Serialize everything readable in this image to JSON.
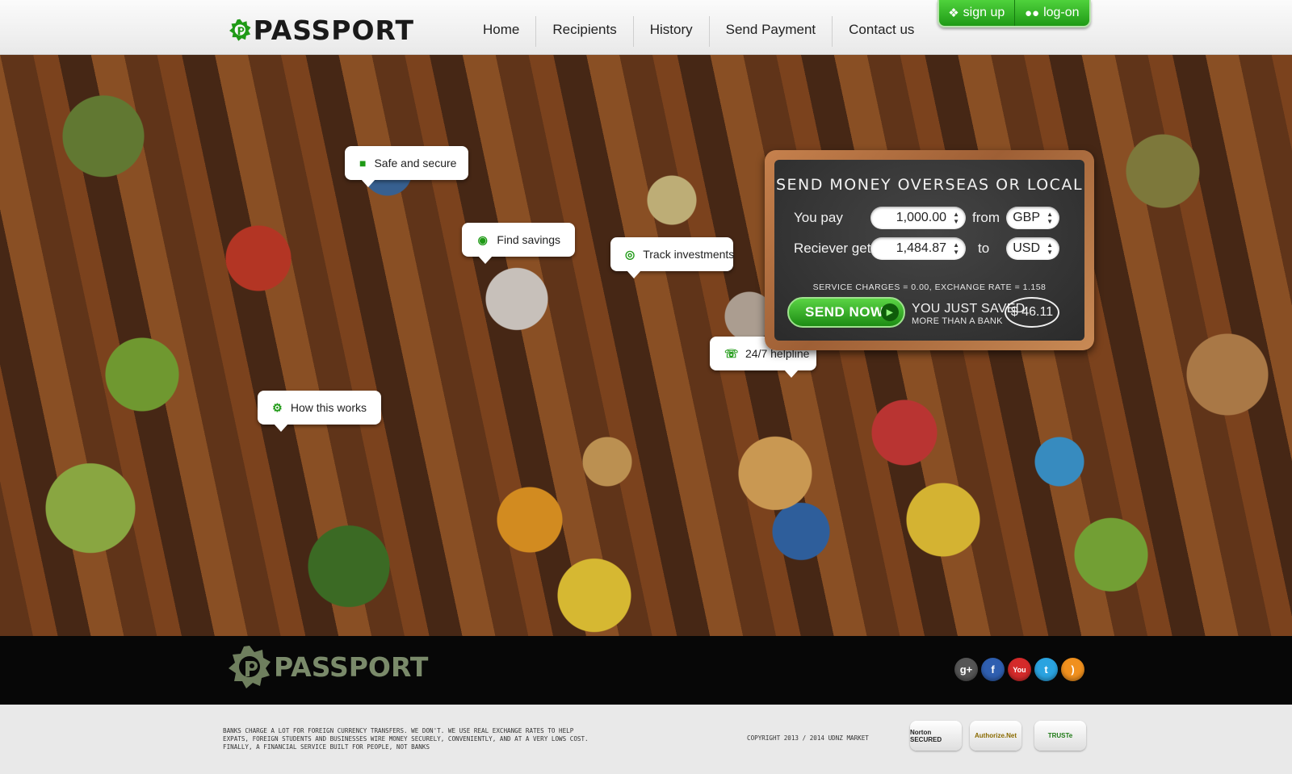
{
  "brand": {
    "name": "PASSPORT",
    "accent": "#1f9a16"
  },
  "nav": {
    "items": [
      {
        "label": "Home"
      },
      {
        "label": "Recipients"
      },
      {
        "label": "History"
      },
      {
        "label": "Send Payment"
      },
      {
        "label": "Contact us"
      }
    ]
  },
  "auth": {
    "signup": {
      "label": "sign up",
      "icon": "signup-person-icon"
    },
    "login": {
      "label": "log-on",
      "icon": "users-icon"
    }
  },
  "features": [
    {
      "label": "Safe and secure",
      "icon": "lock-icon"
    },
    {
      "label": "Find savings",
      "icon": "piggy-bank-icon"
    },
    {
      "label": "Track investments",
      "icon": "target-icon"
    },
    {
      "label": "24/7 helpline",
      "icon": "phone-icon"
    },
    {
      "label": "How this works",
      "icon": "gear-icon"
    }
  ],
  "converter": {
    "title": "SEND MONEY OVERSEAS OR LOCAL",
    "you_pay_label": "You pay",
    "you_pay_value": "1,000.00",
    "from_label": "from",
    "from_currency": "GBP",
    "receiver_label": "Reciever gets",
    "receiver_value": "1,484.87",
    "to_label": "to",
    "to_currency": "USD",
    "charges_text": "SERVICE CHARGES = 0.00, EXCHANGE RATE = 1.158",
    "send_label": "SEND NOW",
    "saved_line1": "YOU JUST SAVED",
    "saved_line2": "MORE THAN A BANK",
    "saved_amount": "$ 46.11"
  },
  "footer": {
    "social": [
      {
        "name": "google-plus-icon",
        "glyph": "g+",
        "color": "#555555"
      },
      {
        "name": "facebook-icon",
        "glyph": "f",
        "color": "#2f5fb0"
      },
      {
        "name": "youtube-icon",
        "glyph": "You",
        "color": "#d42a2a"
      },
      {
        "name": "twitter-icon",
        "glyph": "t",
        "color": "#2aa3e0"
      },
      {
        "name": "rss-icon",
        "glyph": ")",
        "color": "#f0901e"
      }
    ],
    "disclaimer": "Banks charge a lot for foreign currency transfers. We don't. We use real exchange rates to help expats, foreign students and businesses wire money securely, conveniently, and at a very lows cost. Finally, a financial service built for people, not banks",
    "copyright": "COPYRIGHT 2013 / 2014 UDNZ MARKET",
    "badges": [
      {
        "label": "Norton SECURED",
        "icon": "norton-badge-icon"
      },
      {
        "label": "Authorize.Net",
        "icon": "authorize-net-badge-icon"
      },
      {
        "label": "TRUSTe",
        "icon": "truste-badge-icon"
      }
    ]
  }
}
